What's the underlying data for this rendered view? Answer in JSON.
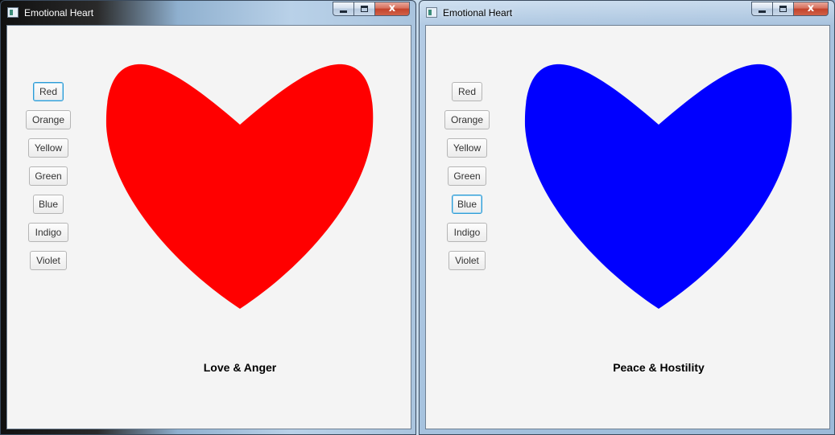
{
  "windows": [
    {
      "title": "Emotional Heart",
      "heart_color": "#ff0000",
      "caption": "Love & Anger",
      "selected": "Red",
      "buttons": [
        "Red",
        "Orange",
        "Yellow",
        "Green",
        "Blue",
        "Indigo",
        "Violet"
      ]
    },
    {
      "title": "Emotional Heart",
      "heart_color": "#0000ff",
      "caption": "Peace & Hostility",
      "selected": "Blue",
      "buttons": [
        "Red",
        "Orange",
        "Yellow",
        "Green",
        "Blue",
        "Indigo",
        "Violet"
      ]
    }
  ],
  "controls": {
    "minimize_icon": "minimize-icon",
    "maximize_icon": "maximize-icon",
    "close_icon": "close-icon",
    "close_glyph": "x"
  }
}
